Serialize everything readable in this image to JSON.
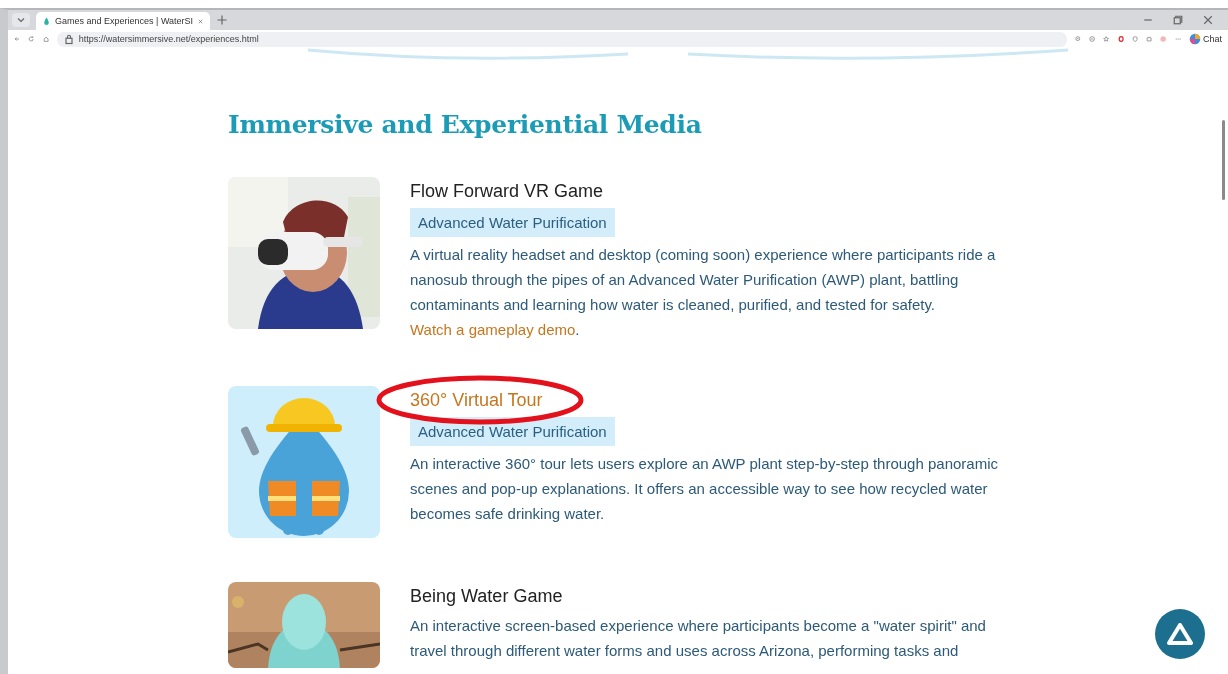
{
  "browser": {
    "tabs": [
      {
        "title": "Games and Experiences | WaterSI",
        "selected": true
      }
    ],
    "url": "https://watersimmersive.net/experiences.html",
    "chat_label": "Chat"
  },
  "page": {
    "heading": "Immersive and Experiential Media",
    "items": [
      {
        "title": "Flow Forward VR Game",
        "title_link": false,
        "circled": false,
        "tag": "Advanced Water Purification",
        "description": "A virtual reality headset and desktop (coming soon) experience where participants ride a nanosub through the pipes of an Advanced Water Purification (AWP) plant, battling contaminants and learning how water is cleaned, purified, and tested for safety. ",
        "link": "Watch a gameplay demo",
        "after_link": "."
      },
      {
        "title": "360° Virtual Tour",
        "title_link": true,
        "circled": true,
        "tag": "Advanced Water Purification",
        "description": "An interactive 360° tour lets users explore an AWP plant step-by-step through panoramic scenes and pop-up explanations. It offers an accessible way to see how recycled water becomes safe drinking water."
      },
      {
        "title": "Being Water Game",
        "title_link": false,
        "circled": false,
        "description": "An interactive screen-based experience where participants become a \"water spirit\" and travel through different water forms and uses across Arizona, performing tasks and"
      }
    ]
  }
}
